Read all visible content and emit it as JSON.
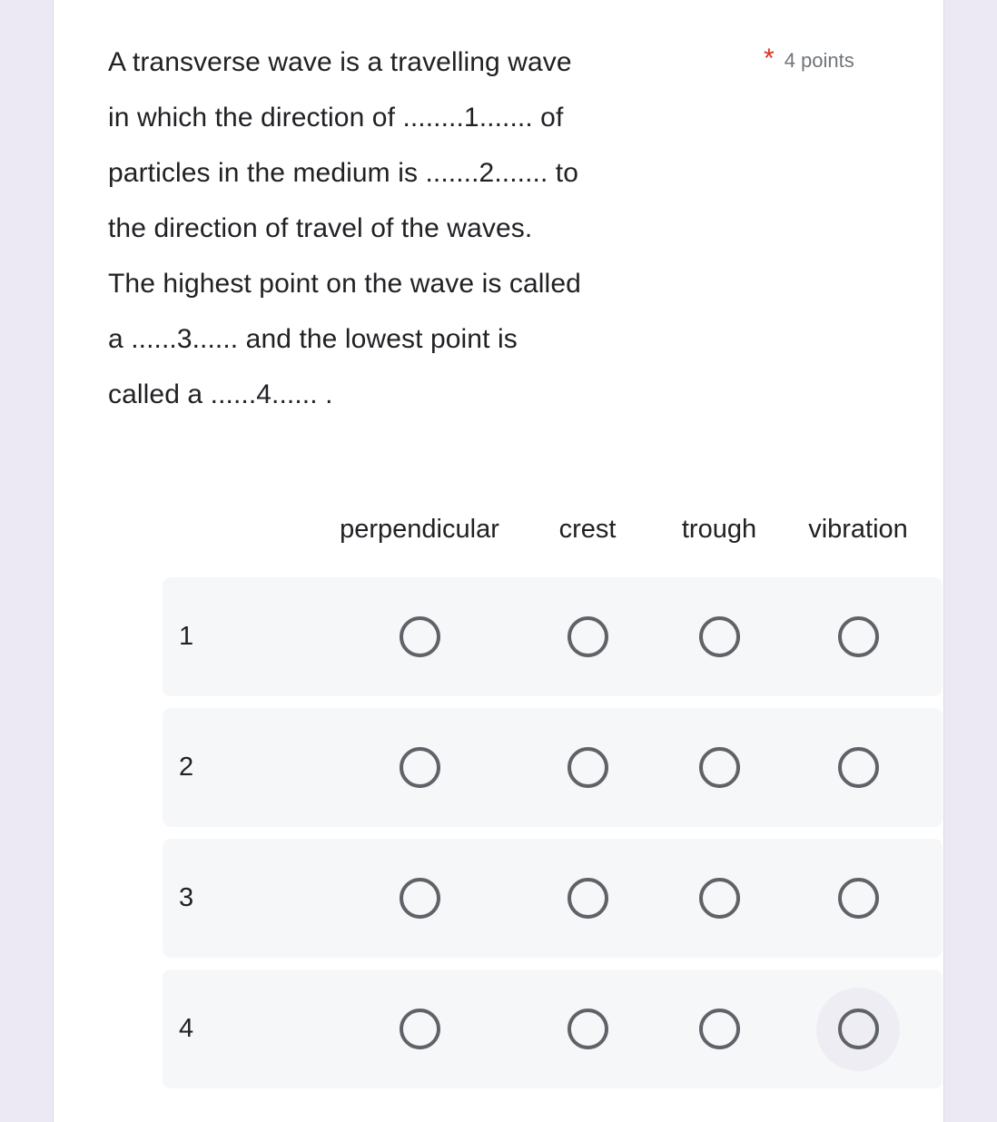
{
  "theme": {
    "page_background": "#ece9f5",
    "card_background": "#ffffff",
    "card_border": "#dadce0",
    "row_background": "#f6f7f9",
    "radio_border": "#5f6368",
    "required_asterisk": "#d93025",
    "points_text": "#70757a",
    "primary_text": "#202124",
    "hover_highlight": "#eeedf4"
  },
  "question": {
    "text": "A transverse wave is a travelling wave\nin which the direction of ........1....... of\nparticles in the medium is .......2....... to\nthe direction of travel of the waves.\nThe highest point on the wave is called\na ......3...... and the lowest point is\ncalled a ......4...... .",
    "required_marker": "*",
    "points": "4 points"
  },
  "grid": {
    "columns": [
      {
        "label": "perpendicular"
      },
      {
        "label": "crest"
      },
      {
        "label": "trough"
      },
      {
        "label": "vibration"
      }
    ],
    "rows": [
      {
        "label": "1",
        "selected": null,
        "hovered": null
      },
      {
        "label": "2",
        "selected": null,
        "hovered": null
      },
      {
        "label": "3",
        "selected": null,
        "hovered": null
      },
      {
        "label": "4",
        "selected": null,
        "hovered": 3
      }
    ]
  }
}
